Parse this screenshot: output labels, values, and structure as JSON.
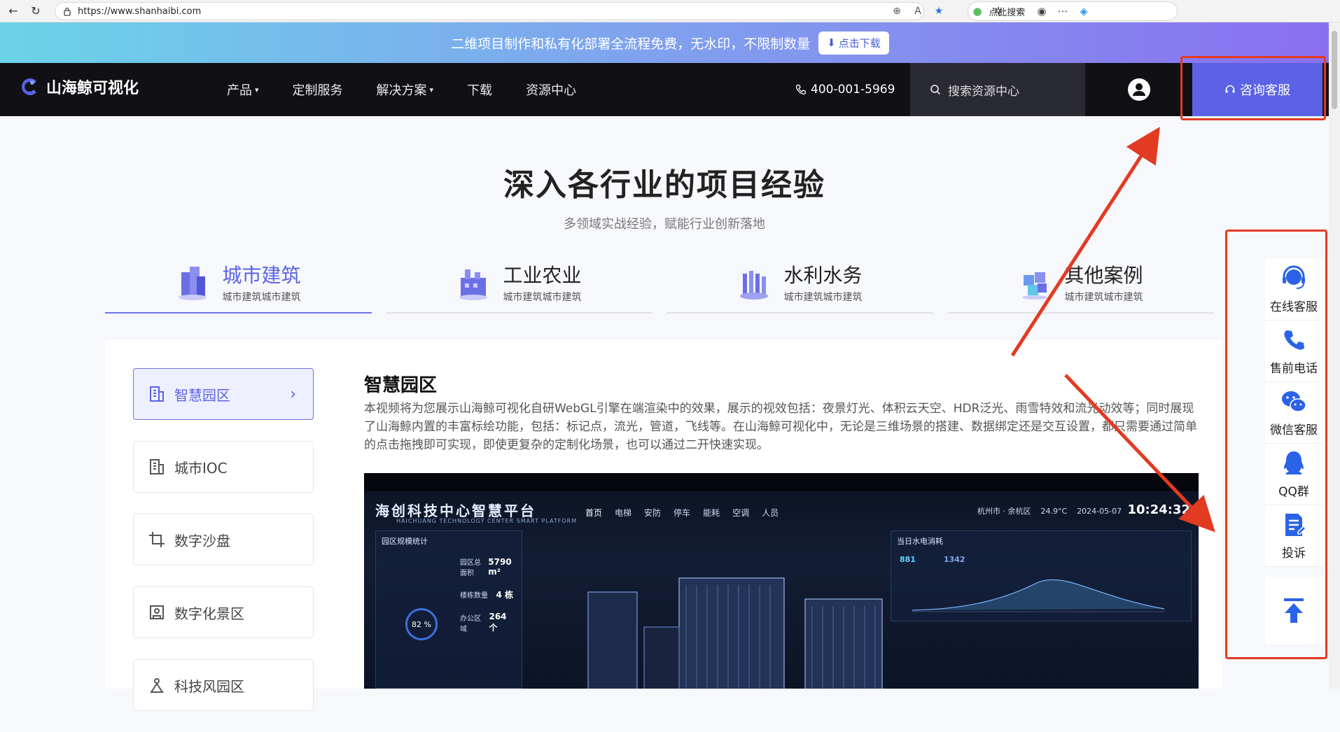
{
  "browser": {
    "url": "https://www.shanhaibi.com",
    "search_placeholder": "点此搜索"
  },
  "promo": {
    "text": "二维项目制作和私有化部署全流程免费，无水印，不限制数量",
    "download_label": "点击下载"
  },
  "header": {
    "logo_text": "山海鲸可视化",
    "nav": [
      {
        "label": "产品",
        "dropdown": true
      },
      {
        "label": "定制服务",
        "dropdown": false
      },
      {
        "label": "解决方案",
        "dropdown": true
      },
      {
        "label": "下载",
        "dropdown": false
      },
      {
        "label": "资源中心",
        "dropdown": false
      }
    ],
    "phone": "400-001-5969",
    "search_placeholder": "搜索资源中心",
    "consult_label": "咨询客服"
  },
  "hero": {
    "title": "深入各行业的项目经验",
    "subtitle": "多领域实战经验，赋能行业创新落地"
  },
  "categories": [
    {
      "name": "城市建筑",
      "desc": "城市建筑城市建筑",
      "icon": "city-building-icon",
      "active": true
    },
    {
      "name": "工业农业",
      "desc": "城市建筑城市建筑",
      "icon": "factory-icon",
      "active": false
    },
    {
      "name": "水利水务",
      "desc": "城市建筑城市建筑",
      "icon": "water-icon",
      "active": false
    },
    {
      "name": "其他案例",
      "desc": "城市建筑城市建筑",
      "icon": "cubes-icon",
      "active": false
    }
  ],
  "sidebar": {
    "items": [
      {
        "label": "智慧园区",
        "icon": "building-icon",
        "active": true
      },
      {
        "label": "城市IOC",
        "icon": "building-icon",
        "active": false
      },
      {
        "label": "数字沙盘",
        "icon": "crop-icon",
        "active": false
      },
      {
        "label": "数字化景区",
        "icon": "scenic-icon",
        "active": false
      },
      {
        "label": "科技风园区",
        "icon": "tech-icon",
        "active": false
      }
    ]
  },
  "detail": {
    "title": "智慧园区",
    "description": "本视频将为您展示山海鲸可视化自研WebGL引擎在端渲染中的效果，展示的视效包括：夜景灯光、体积云天空、HDR泛光、雨雪特效和流光动效等；同时展现了山海鲸内置的丰富标绘功能，包括：标记点，流光，管道，飞线等。在山海鲸可视化中，无论是三维场景的搭建、数据绑定还是交互设置，都只需要通过简单的点击拖拽即可实现，即使更复杂的定制化场景，也可以通过二开快速实现。"
  },
  "preview": {
    "platform_title": "海创科技中心智慧平台",
    "platform_sub": "HAICHUANG TECHNOLOGY CENTER SMART PLATFORM",
    "nav": [
      "首页",
      "电梯",
      "安防",
      "停车",
      "能耗",
      "空调",
      "人员"
    ],
    "location": "杭州市 · 余杭区",
    "temperature": "24.9°C",
    "date": "2024-05-07",
    "clock": "10:24:32",
    "left_panel_title": "园区规模统计",
    "stats": [
      {
        "label": "园区总面积",
        "value": "5790 m²"
      },
      {
        "label": "楼栋数量",
        "value": "4 栋"
      },
      {
        "label": "办公区域",
        "value": "264 个"
      }
    ],
    "ring_value": "82 %",
    "right_panel_title": "当日水电消耗",
    "water_value": "881",
    "power_value": "1342"
  },
  "floatbar": {
    "items": [
      {
        "label": "在线客服",
        "icon": "headset-icon"
      },
      {
        "label": "售前电话",
        "icon": "phone-icon"
      },
      {
        "label": "微信客服",
        "icon": "wechat-icon"
      },
      {
        "label": "QQ群",
        "icon": "qq-icon"
      },
      {
        "label": "投诉",
        "icon": "complaint-icon"
      }
    ]
  },
  "colors": {
    "accent": "#5b62e6",
    "annotation": "#e33a22",
    "header_bg": "#101015"
  }
}
